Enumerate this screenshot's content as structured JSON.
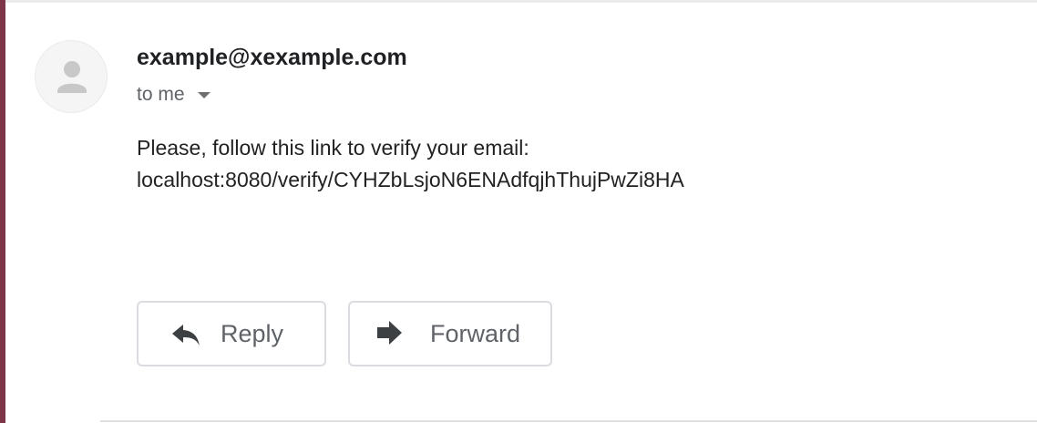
{
  "email": {
    "sender": "example@xexample.com",
    "recipient": "to me",
    "body_line1": "Please, follow this link to verify your email:",
    "body_line2": "localhost:8080/verify/CYHZbLsjoN6ENAdfqjhThujPwZi8HA"
  },
  "actions": {
    "reply_label": "Reply",
    "forward_label": "Forward"
  },
  "icons": {
    "avatar": "person-icon",
    "recipient_toggle": "caret-down-icon",
    "reply": "reply-arrow-icon",
    "forward": "forward-arrow-icon"
  },
  "colors": {
    "accent_left_bar": "#7d3547",
    "button_border": "#dadce0",
    "button_text": "#5f6368",
    "sender_text": "#202124",
    "body_text": "#222222"
  }
}
